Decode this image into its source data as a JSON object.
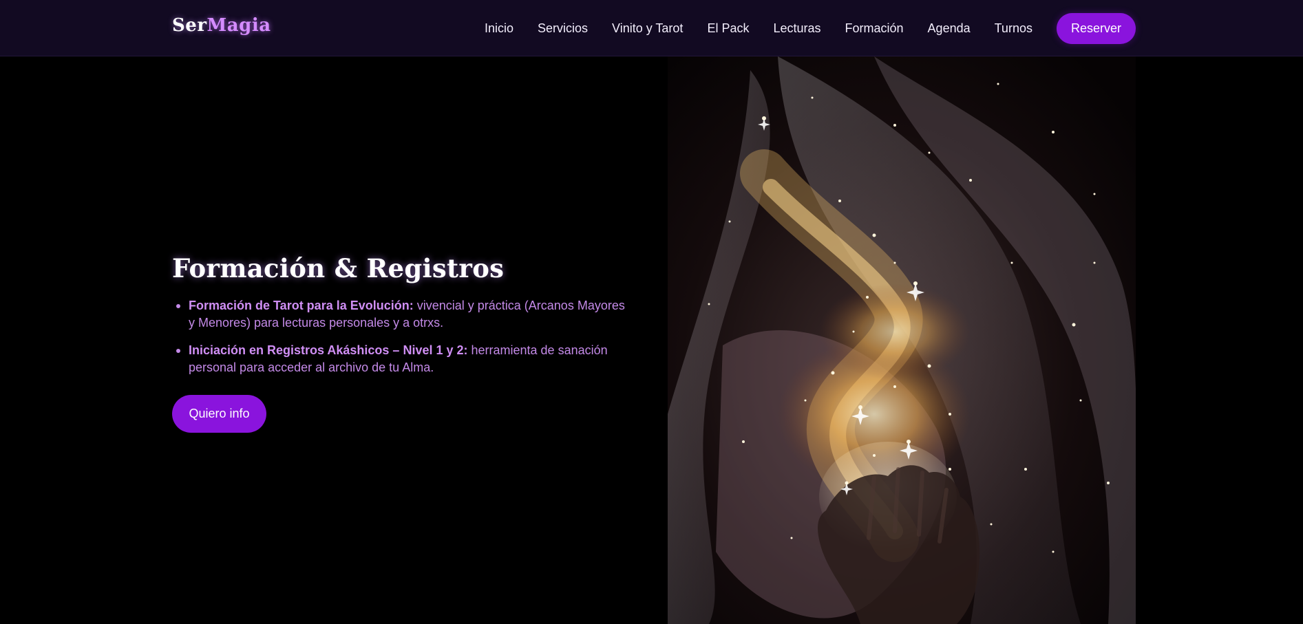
{
  "brand": {
    "part1": "Ser",
    "part2": "Magia"
  },
  "nav": {
    "items": [
      "Inicio",
      "Servicios",
      "Vinito y Tarot",
      "El Pack",
      "Lecturas",
      "Formación",
      "Agenda",
      "Turnos"
    ],
    "cta": "Reserver"
  },
  "hero": {
    "title": "Formación & Registros",
    "bullets": [
      {
        "strong": "Formación de Tarot para la Evolución:",
        "text": " vivencial y práctica (Arcanos Mayores y Menores) para lecturas personales y a otrxs."
      },
      {
        "strong": "Iniciación en Registros Akáshicos – Nivel 1 y 2:",
        "text": " herramienta de sanación personal para acceder al archivo de tu Alma."
      }
    ],
    "button": "Quiero info"
  },
  "colors": {
    "accent": "#8a14dd",
    "nav_bg": "#120a22",
    "text_purple": "#c48ae8",
    "brand_pink": "#d58cff"
  },
  "image": {
    "subject": "cosmic-hand-nebula-illustration"
  }
}
